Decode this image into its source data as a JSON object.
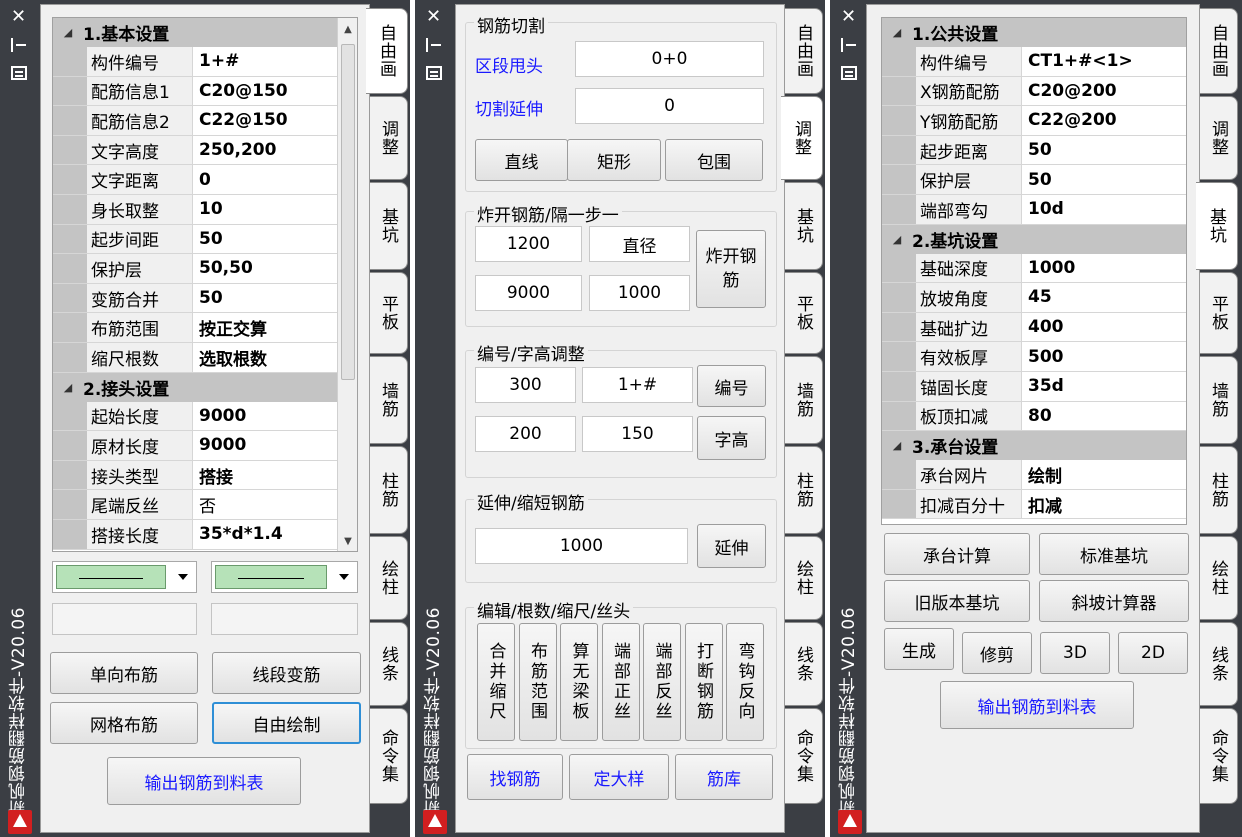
{
  "app_title": "新帆钢筋翻样软件-V20.06",
  "side_tabs": [
    "自由画",
    "调整",
    "基坑",
    "平板",
    "墙筋",
    "柱筋",
    "绘柱",
    "线条",
    "命令集"
  ],
  "panel1": {
    "sections": [
      {
        "title": "1.基本设置",
        "rows": [
          {
            "key": "构件编号",
            "value": "1+#"
          },
          {
            "key": "配筋信息1",
            "value": "C20@150"
          },
          {
            "key": "配筋信息2",
            "value": "C22@150"
          },
          {
            "key": "文字高度",
            "value": "250,200"
          },
          {
            "key": "文字距离",
            "value": "0"
          },
          {
            "key": "身长取整",
            "value": "10"
          },
          {
            "key": "起步间距",
            "value": "50"
          },
          {
            "key": "保护层",
            "value": "50,50"
          },
          {
            "key": "变筋合并",
            "value": "50"
          },
          {
            "key": "布筋范围",
            "value": "按正交算"
          },
          {
            "key": "缩尺根数",
            "value": "选取根数"
          }
        ]
      },
      {
        "title": "2.接头设置",
        "rows": [
          {
            "key": "起始长度",
            "value": "9000"
          },
          {
            "key": "原材长度",
            "value": "9000"
          },
          {
            "key": "接头类型",
            "value": "搭接"
          },
          {
            "key": "尾端反丝",
            "value": "否"
          },
          {
            "key": "搭接长度",
            "value": "35*d*1.4"
          }
        ]
      }
    ],
    "buttons": {
      "single": "单向布筋",
      "segment": "线段变筋",
      "mesh": "网格布筋",
      "free": "自由绘制",
      "export": "输出钢筋到料表"
    }
  },
  "panel2": {
    "cut": {
      "title": "钢筋切割",
      "seg_label": "区段甩头",
      "seg_value": "0+0",
      "ext_label": "切割延伸",
      "ext_value": "0",
      "line": "直线",
      "rect": "矩形",
      "wrap": "包围"
    },
    "explode": {
      "title": "炸开钢筋/隔一步一",
      "v1": "1200",
      "v2": "直径",
      "v3": "9000",
      "v4": "1000",
      "btn": "炸开钢筋"
    },
    "number": {
      "title": "编号/字高调整",
      "v1": "300",
      "v2": "1+#",
      "v3": "200",
      "v4": "150",
      "btn_num": "编号",
      "btn_height": "字高"
    },
    "extend": {
      "title": "延伸/缩短钢筋",
      "value": "1000",
      "btn": "延伸"
    },
    "edit": {
      "title": "编辑/根数/缩尺/丝头",
      "buttons": [
        "合并缩尺",
        "布筋范围",
        "算无梁板",
        "端部正丝",
        "端部反丝",
        "打断钢筋",
        "弯钩反向"
      ]
    },
    "bottom": {
      "find": "找钢筋",
      "detail": "定大样",
      "lib": "筋库"
    }
  },
  "panel3": {
    "sections": [
      {
        "title": "1.公共设置",
        "rows": [
          {
            "key": "构件编号",
            "value": "CT1+#<1>"
          },
          {
            "key": "X钢筋配筋",
            "value": "C20@200"
          },
          {
            "key": "Y钢筋配筋",
            "value": "C22@200"
          },
          {
            "key": "起步距离",
            "value": "50"
          },
          {
            "key": "保护层",
            "value": "50"
          },
          {
            "key": "端部弯勾",
            "value": "10d"
          }
        ]
      },
      {
        "title": "2.基坑设置",
        "rows": [
          {
            "key": "基础深度",
            "value": "1000"
          },
          {
            "key": "放坡角度",
            "value": "45"
          },
          {
            "key": "基础扩边",
            "value": "400"
          },
          {
            "key": "有效板厚",
            "value": "500"
          },
          {
            "key": "锚固长度",
            "value": "35d"
          },
          {
            "key": "板顶扣减",
            "value": "80"
          }
        ]
      },
      {
        "title": "3.承台设置",
        "rows": [
          {
            "key": "承台网片",
            "value": "绘制"
          },
          {
            "key": "扣减百分十",
            "value": "扣减"
          }
        ]
      }
    ],
    "buttons": {
      "cap_calc": "承台计算",
      "std_pit": "标准基坑",
      "old_pit": "旧版本基坑",
      "slope": "斜坡计算器",
      "gen": "生成",
      "trim": "修剪",
      "d3": "3D",
      "d2": "2D",
      "export": "输出钢筋到料表"
    }
  }
}
